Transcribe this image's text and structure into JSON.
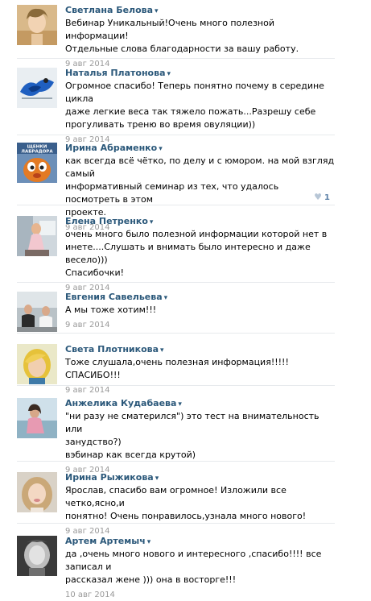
{
  "comments": [
    {
      "author": "Светлана Белова",
      "text": "Вебинар Уникальный!Очень много полезной информации!\nОтдельные слова благодарности за вашу работу.",
      "date": "9 авг 2014"
    },
    {
      "author": "Наталья Платонова",
      "text": "Огромное спасибо! Теперь понятно почему в середине цикла\nдаже легкие веса так тяжело пожать...Разрешу себе\nпрогуливать треню во время овуляции))",
      "date": "9 авг 2014"
    },
    {
      "author": "Ирина Абраменко",
      "text": "как всегда всё чётко, по делу и с юмором. на мой взгляд самый\nинформативный семинар из тех, что удалось посмотреть в этом\nпроекте.",
      "date": "9 авг 2014",
      "likes": "1",
      "avatar_caption_1": "ЩЕНКИ",
      "avatar_caption_2": "ЛАБРАДОРА"
    },
    {
      "author": "Елена Петренко",
      "text": "очень много было полезной информации которой нет в\nинете....Слушать и внимать было интересно и даже весело)))\nСпасибочки!",
      "date": "9 авг 2014"
    },
    {
      "author": "Евгения Савельева",
      "text": "А мы тоже хотим!!!",
      "date": "9 авг 2014"
    },
    {
      "author": "Света Плотникова",
      "text": "Тоже слушала,очень полезная информация!!!!! СПАСИБО!!!",
      "date": "9 авг 2014"
    },
    {
      "author": "Анжелика Кудабаева",
      "text": "\"ни разу не сматерился\") это тест на внимательность или\nзанудство?)\nвэбинар как всегда крутой)",
      "date": "9 авг 2014"
    },
    {
      "author": "Ирина Рыжикова",
      "text": "Ярослав, спасибо вам огромное! Изложили все четко,ясно,и\nпонятно! Очень понравилось,узнала много нового!",
      "date": "9 авг 2014"
    },
    {
      "author": "Артем Артемыч",
      "text": "да ,очень много нового и интересного ,спасибо!!!! все записал и\nрассказал жене ))) она в восторге!!!",
      "date": "10 авг 2014"
    }
  ],
  "colors": {
    "author": "#2b587a",
    "date": "#999999",
    "divider": "#e7eaed"
  },
  "icons": {
    "menu_arrow": "▾",
    "like": "♥"
  }
}
